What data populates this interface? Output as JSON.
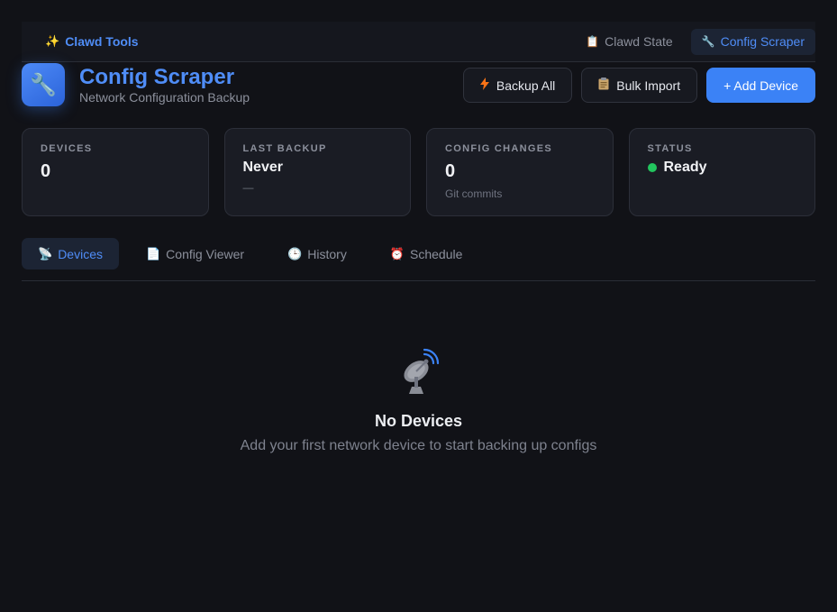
{
  "nav": {
    "brand": "Clawd Tools",
    "brand_icon": "✨",
    "links": [
      {
        "label": "Clawd State",
        "icon": "📋"
      },
      {
        "label": "Config Scraper",
        "icon": "🔧"
      }
    ]
  },
  "header": {
    "icon": "🔧",
    "title": "Config Scraper",
    "subtitle": "Network Configuration Backup"
  },
  "actions": {
    "backup_all": "Backup All",
    "bulk_import": "Bulk Import",
    "add_device": "+ Add Device"
  },
  "stats": {
    "devices": {
      "label": "DEVICES",
      "value": "0"
    },
    "last_backup": {
      "label": "LAST BACKUP",
      "value": "Never",
      "sub": "—"
    },
    "config_changes": {
      "label": "CONFIG CHANGES",
      "value": "0",
      "sub": "Git commits"
    },
    "status": {
      "label": "STATUS",
      "value": "Ready"
    }
  },
  "tabs": [
    {
      "label": "Devices",
      "icon": "📡"
    },
    {
      "label": "Config Viewer",
      "icon": "📄"
    },
    {
      "label": "History",
      "icon": "🕒"
    },
    {
      "label": "Schedule",
      "icon": "⏰"
    }
  ],
  "empty": {
    "title": "No Devices",
    "description": "Add your first network device to start backing up configs"
  },
  "colors": {
    "accent": "#3b82f6",
    "status_ready": "#22c55e",
    "background": "#111217"
  }
}
